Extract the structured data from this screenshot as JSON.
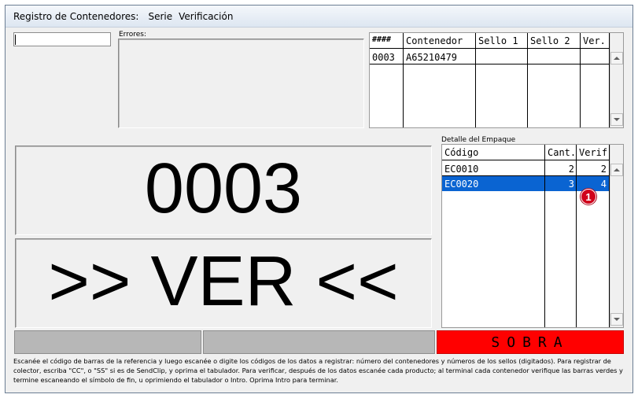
{
  "menu": {
    "items": [
      "Registro de Contenedores:",
      "Serie",
      "Verificación"
    ]
  },
  "input": {
    "value": ""
  },
  "errors": {
    "label": "Errores:"
  },
  "containers_table": {
    "headers": [
      "####",
      "Contenedor",
      "Sello 1",
      "Sello 2",
      "Ver."
    ],
    "rows": [
      {
        "num": "0003",
        "contenedor": "A65210479",
        "sello1": "",
        "sello2": "",
        "ver": ""
      }
    ]
  },
  "big_number": "0003",
  "status_text": ">> VER <<",
  "detail": {
    "label": "Detalle del Empaque",
    "headers": [
      "Código",
      "Cant.",
      "Verif."
    ],
    "rows": [
      {
        "codigo": "EC0010",
        "cant": "2",
        "verif": "2",
        "selected": false
      },
      {
        "codigo": "EC0020",
        "cant": "3",
        "verif": "4",
        "selected": true
      }
    ]
  },
  "badge": "1",
  "status_bars": {
    "sobra": "SOBRA",
    "sobra_color": "#ff0000",
    "neutral_color": "#b7b7b7"
  },
  "instructions": "Escanée el código de barras de la referencia y luego escanée o digite los códigos de los datos a registrar: número del contenedores y números de los sellos (digitados). Para registrar de colector, escriba \"CC\", o \"SS\" si es de SendClip, y oprima el tabulador. Para verificar, después de los datos escanée cada producto; al terminal cada contenedor verifique las barras verdes y termine escaneando el símbolo de fin, u oprimiendo el tabulador o Intro. Oprima Intro para terminar."
}
